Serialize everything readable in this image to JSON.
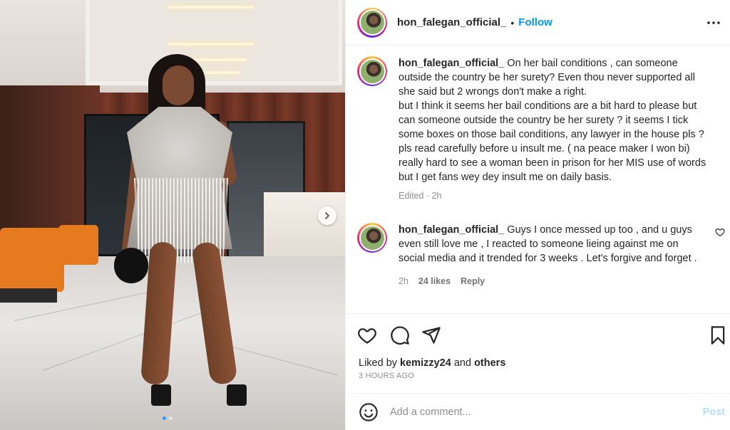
{
  "post": {
    "username": "hon_falegan_official_",
    "bullet": "•",
    "follow_label": "Follow"
  },
  "comments": [
    {
      "username": "hon_falegan_official_",
      "text": "On her bail conditions , can someone outside the country be her surety? Even thou never supported all she said but 2 wrongs don't make a right.\nbut I think it seems her bail conditions are a bit hard to please but can someone outside the country be her surety ? it seems I tick some boxes on those bail conditions, any lawyer in the house pls ? pls read carefully before u insult me. ( na peace maker I won bi) really hard to see a woman been in prison for her MIS use of words but I get fans wey dey insult me on daily basis.",
      "meta": "Edited · 2h"
    },
    {
      "username": "hon_falegan_official_",
      "text": "Guys I once messed up too , and u guys even still love me , I reacted to someone lieing against me on social media and it trended for 3 weeks . Let's forgive and forget .",
      "time": "2h",
      "likes": "24 likes",
      "reply": "Reply"
    }
  ],
  "likes": {
    "prefix": "Liked by",
    "user": "kemizzy24",
    "and": "and",
    "others": "others"
  },
  "timestamp": "3 HOURS AGO",
  "add_comment": {
    "placeholder": "Add a comment...",
    "post_label": "Post"
  },
  "icons": {
    "header_avatar": "avatar-icon",
    "more": "more-horizontal-icon",
    "like": "heart-icon",
    "comment": "comment-bubble-icon",
    "share": "paper-plane-icon",
    "save": "bookmark-icon",
    "emoji": "emoji-smile-icon",
    "next": "chevron-right-icon",
    "comment_like": "small-heart-icon"
  },
  "colors": {
    "accent": "#0095f6",
    "post_disabled": "#b2dffc",
    "meta_gray": "#8e8e8e"
  },
  "carousel": {
    "count": 2,
    "active_index": 0
  }
}
